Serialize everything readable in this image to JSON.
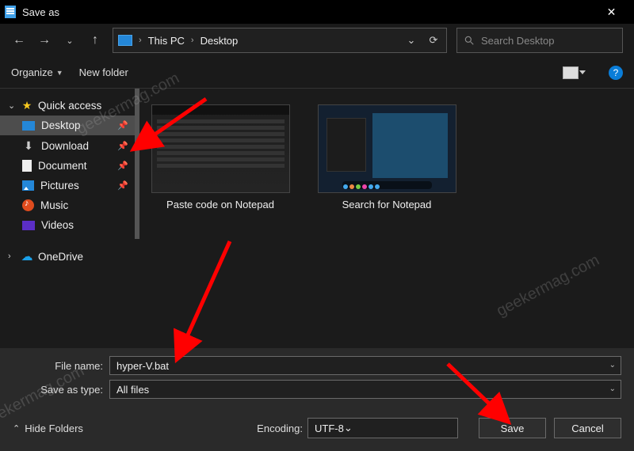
{
  "titlebar": {
    "title": "Save as"
  },
  "nav": {
    "breadcrumb": [
      "This PC",
      "Desktop"
    ],
    "search_placeholder": "Search Desktop"
  },
  "toolbar": {
    "organize": "Organize",
    "new_folder": "New folder"
  },
  "sidebar": {
    "quick_access": "Quick access",
    "items": [
      {
        "label": "Desktop",
        "pinned": true,
        "selected": true
      },
      {
        "label": "Download",
        "pinned": true,
        "selected": false
      },
      {
        "label": "Document",
        "pinned": true,
        "selected": false
      },
      {
        "label": "Pictures",
        "pinned": true,
        "selected": false
      },
      {
        "label": "Music",
        "pinned": false,
        "selected": false
      },
      {
        "label": "Videos",
        "pinned": false,
        "selected": false
      }
    ],
    "onedrive": "OneDrive"
  },
  "content": {
    "files": [
      {
        "caption": "Paste code on Notepad"
      },
      {
        "caption": "Search for Notepad"
      }
    ]
  },
  "form": {
    "file_name_label": "File name:",
    "file_name_value": "hyper-V.bat",
    "save_as_type_label": "Save as type:",
    "save_as_type_value": "All files"
  },
  "footer": {
    "hide_folders": "Hide Folders",
    "encoding_label": "Encoding:",
    "encoding_value": "UTF-8",
    "save": "Save",
    "cancel": "Cancel"
  },
  "watermark": "geekermag.com"
}
